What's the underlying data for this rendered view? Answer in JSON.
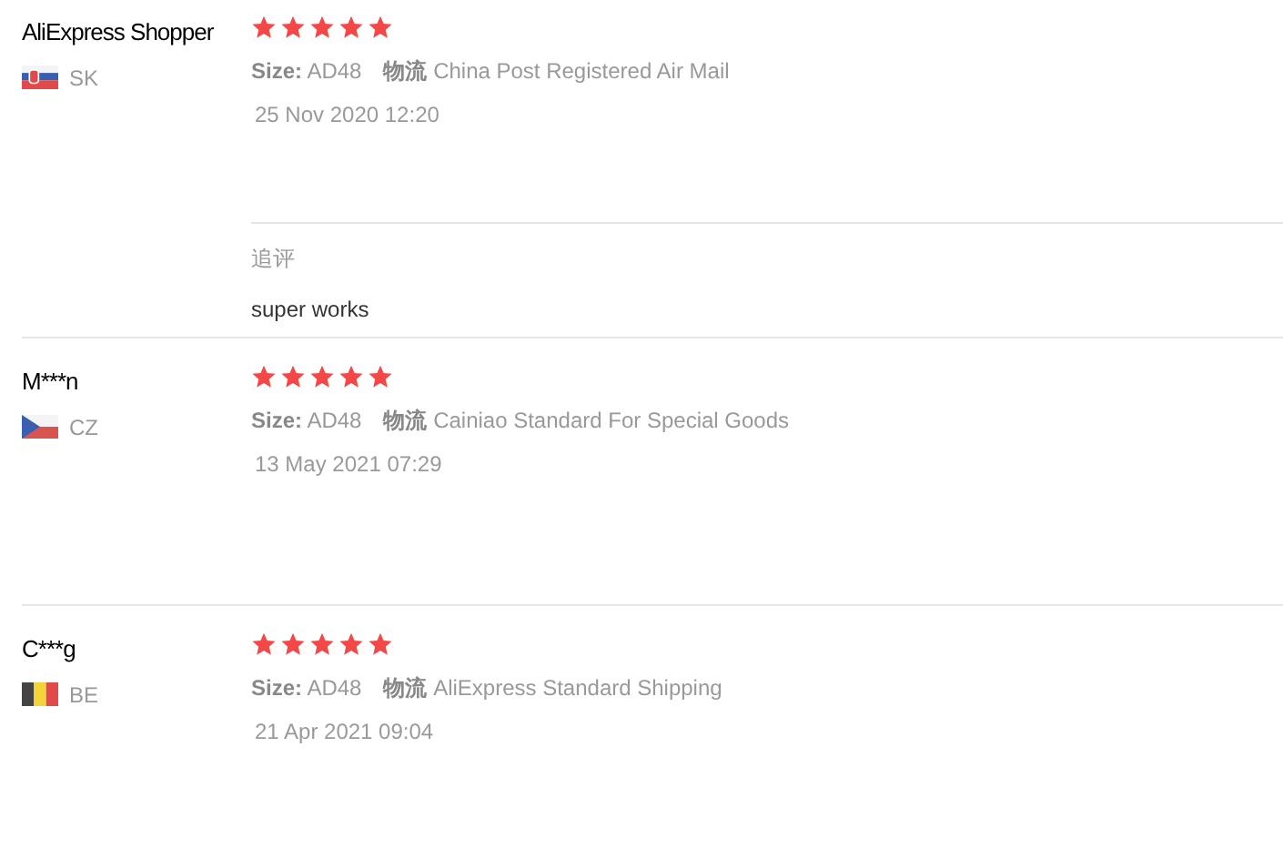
{
  "reviews": [
    {
      "name": "AliExpress Shopper",
      "flag": {
        "kind": "slovakia"
      },
      "country": "SK",
      "stars": 5,
      "size_label": "Size:",
      "size": "AD48",
      "shipping_label": "物流",
      "shipping": "China Post Registered Air Mail",
      "date": "25 Nov 2020 12:20",
      "followup": {
        "label": "追评",
        "text": "super works"
      }
    },
    {
      "name": "M***n",
      "flag": {
        "kind": "czechia"
      },
      "country": "CZ",
      "stars": 5,
      "size_label": "Size:",
      "size": "AD48",
      "shipping_label": "物流",
      "shipping": "Cainiao Standard For Special Goods",
      "date": "13 May 2021 07:29"
    },
    {
      "name": "C***g",
      "flag": {
        "kind": "belgium"
      },
      "country": "BE",
      "stars": 5,
      "size_label": "Size:",
      "size": "AD48",
      "shipping_label": "物流",
      "shipping": "AliExpress Standard Shipping",
      "date": "21 Apr 2021 09:04"
    }
  ]
}
